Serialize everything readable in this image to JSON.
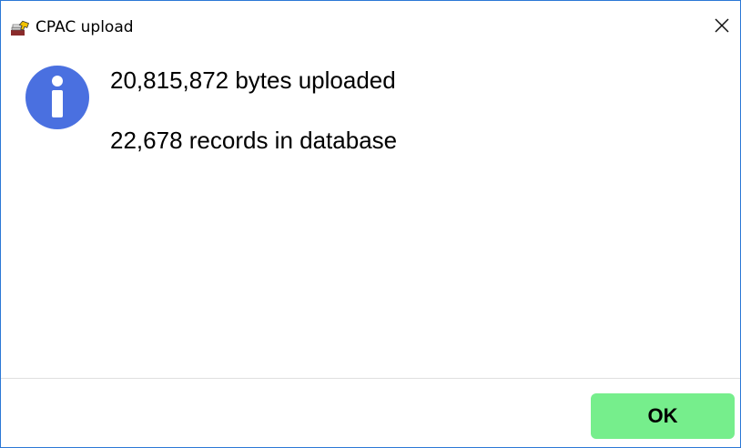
{
  "window": {
    "title": "CPAC upload",
    "close_glyph": "✕",
    "app_icon": "upload-app-icon",
    "close_icon": "close-icon"
  },
  "message": {
    "icon": "info-icon",
    "icon_color": "#4a70e0",
    "line1": "20,815,872 bytes uploaded",
    "line2": "22,678 records in database"
  },
  "footer": {
    "ok_label": "OK",
    "ok_color": "#76ee8c"
  },
  "accent_border_color": "#2b78d6"
}
